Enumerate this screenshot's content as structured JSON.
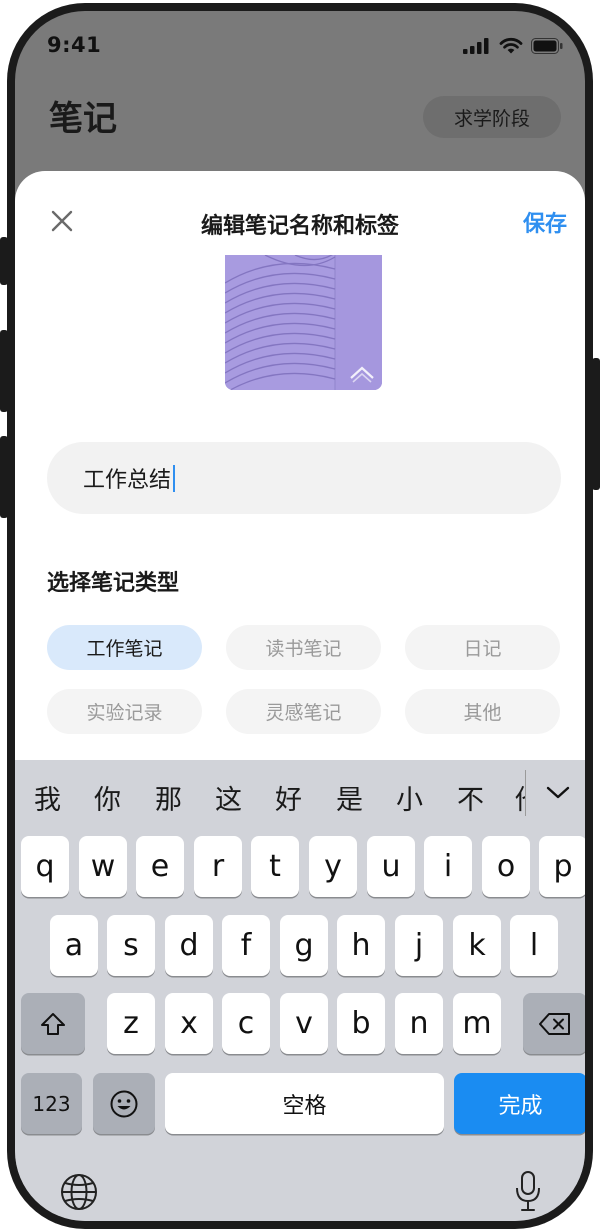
{
  "status": {
    "time": "9:41"
  },
  "background": {
    "title": "笔记",
    "stage_button": "求学阶段"
  },
  "sheet": {
    "title": "编辑笔记名称和标签",
    "save": "保存",
    "name_value": "工作总结",
    "section_title": "选择笔记类型",
    "types": [
      {
        "label": "工作笔记",
        "selected": true
      },
      {
        "label": "读书笔记",
        "selected": false
      },
      {
        "label": "日记",
        "selected": false
      },
      {
        "label": "实验记录",
        "selected": false
      },
      {
        "label": "灵感笔记",
        "selected": false
      },
      {
        "label": "其他",
        "selected": false
      }
    ]
  },
  "keyboard": {
    "candidates": [
      "我",
      "你",
      "那",
      "这",
      "好",
      "是",
      "小",
      "不",
      "他"
    ],
    "row1": [
      "q",
      "w",
      "e",
      "r",
      "t",
      "y",
      "u",
      "i",
      "o",
      "p"
    ],
    "row2": [
      "a",
      "s",
      "d",
      "f",
      "g",
      "h",
      "j",
      "k",
      "l"
    ],
    "row3": [
      "z",
      "x",
      "c",
      "v",
      "b",
      "n",
      "m"
    ],
    "numbers_key": "123",
    "space_key": "空格",
    "done_key": "完成"
  },
  "colors": {
    "accent": "#2f8ff0",
    "done_key": "#1a8cf2",
    "selected_chip": "#d9e9fb",
    "cover": "#a89be0"
  }
}
